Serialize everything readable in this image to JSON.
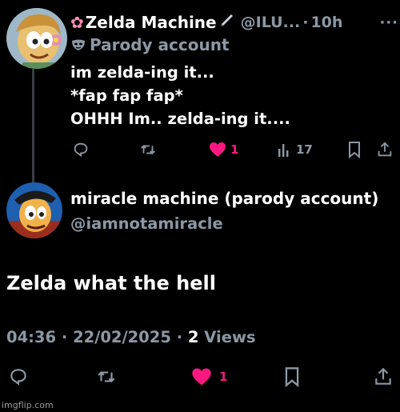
{
  "colors": {
    "background": "#000000",
    "primary_text": "#ffffff",
    "secondary_text": "#8b98a5",
    "like": "#f91880",
    "thread_line": "#3a3d41"
  },
  "parent_tweet": {
    "author_name": "Zelda Machine",
    "handle": "@ILU...",
    "separator": "·",
    "time": "10h",
    "more_icon": "more-horizontal-icon",
    "parody_label": "Parody account",
    "lines": [
      "im zelda-ing it...",
      "*fap fap fap*",
      "OHHH Im.. zelda-ing it...."
    ],
    "actions": {
      "reply_icon": "reply-icon",
      "retweet_icon": "retweet-icon",
      "like_icon": "heart-filled-icon",
      "like_count": "1",
      "views_icon": "views-chart-icon",
      "views_count": "17",
      "bookmark_icon": "bookmark-icon",
      "share_icon": "share-icon"
    }
  },
  "main_tweet": {
    "author_name": "miracle machine (parody account)",
    "handle": "@iamnotamiracle",
    "text": "Zelda what the hell",
    "time": "04:36",
    "date": "22/02/2025",
    "separator": "·",
    "views_count": "2",
    "views_label": "Views",
    "actions": {
      "reply_icon": "reply-icon",
      "retweet_icon": "retweet-icon",
      "like_icon": "heart-filled-icon",
      "like_count": "1",
      "bookmark_icon": "bookmark-icon",
      "share_icon": "share-icon"
    }
  },
  "watermark": "imgflip.com"
}
